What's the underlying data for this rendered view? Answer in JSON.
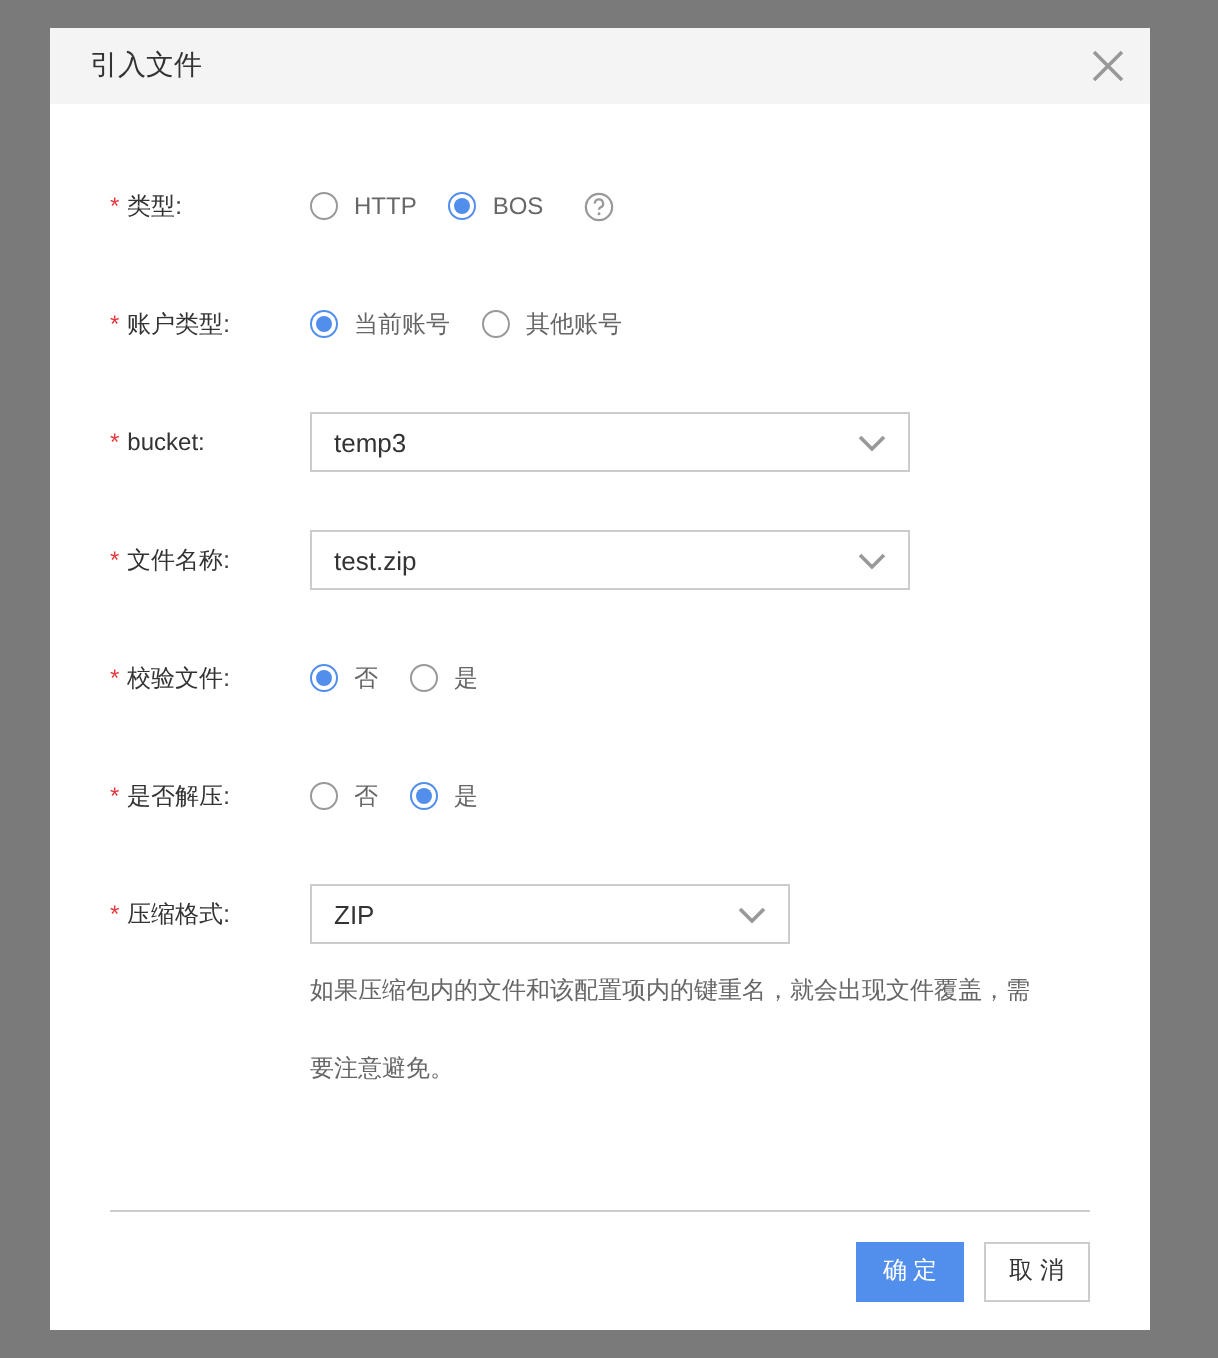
{
  "dialog": {
    "title": "引入文件"
  },
  "fields": [
    {
      "kind": "radio",
      "mark": "*",
      "label": "类型:",
      "options": [
        {
          "label": "HTTP",
          "selected": false
        },
        {
          "label": "BOS",
          "selected": true
        }
      ],
      "help_icon": true
    },
    {
      "kind": "radio",
      "mark": "*",
      "label": "账户类型:",
      "options": [
        {
          "label": "当前账号",
          "selected": true
        },
        {
          "label": "其他账号",
          "selected": false
        }
      ]
    },
    {
      "kind": "select",
      "mark": "*",
      "label": "bucket:",
      "value": "temp3"
    },
    {
      "kind": "select",
      "mark": "*",
      "label": "文件名称:",
      "value": "test.zip"
    },
    {
      "kind": "radio",
      "mark": "*",
      "label": "校验文件:",
      "options": [
        {
          "label": "否",
          "selected": true
        },
        {
          "label": "是",
          "selected": false
        }
      ]
    },
    {
      "kind": "radio",
      "mark": "*",
      "label": "是否解压:",
      "options": [
        {
          "label": "否",
          "selected": false
        },
        {
          "label": "是",
          "selected": true
        }
      ]
    },
    {
      "kind": "select",
      "mark": "*",
      "label": "压缩格式:",
      "value": "ZIP",
      "help": "如果压缩包内的文件和该配置项内的键重名，就会出现文件覆盖，需要注意避免。"
    }
  ],
  "buttons": [
    {
      "label": "确 定",
      "kind": "primary"
    },
    {
      "label": "取 消",
      "kind": "default"
    }
  ]
}
